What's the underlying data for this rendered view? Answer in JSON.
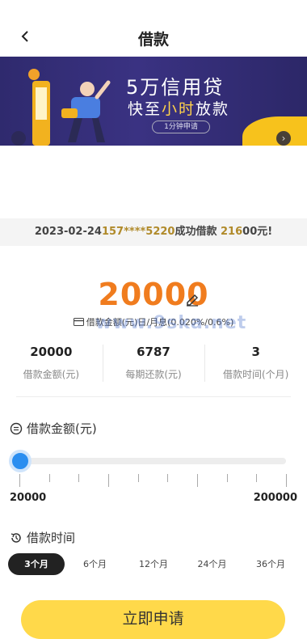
{
  "header": {
    "title": "借款",
    "back_icon": "chevron-left-icon"
  },
  "banner": {
    "title": "5万信用贷",
    "subtitle_pre": "快至",
    "subtitle_hl": "小时",
    "subtitle_post": "放款",
    "button": "1分钟申请",
    "accent_color": "#ffd24a"
  },
  "notice": {
    "date": "2023-02-24",
    "phone": "157****5220",
    "action": "成功借款 ",
    "amount_hl": "216",
    "amount_rest": "00元!"
  },
  "loan": {
    "amount": "20000",
    "rate_text": "借款金额(元)日/月息(0.020%/0.6%)",
    "watermark": "www.9ska.net"
  },
  "stats": [
    {
      "value": "20000",
      "label": "借款金额(元)"
    },
    {
      "value": "6787",
      "label": "每期还款(元)"
    },
    {
      "value": "3",
      "label": "借款时间(个月)"
    }
  ],
  "amount_section": {
    "title": "借款金额(元)",
    "min": "20000",
    "max": "200000",
    "slider_fraction": 0.0
  },
  "term_section": {
    "title": "借款时间",
    "options": [
      "3个月",
      "6个月",
      "12个月",
      "24个月",
      "36个月"
    ],
    "selected": "3个月"
  },
  "apply_button": "立即申请",
  "colors": {
    "orange": "#f07c1e",
    "yellow": "#ffd94a",
    "blue": "#2b8ef0",
    "gold": "#b08a2a"
  }
}
